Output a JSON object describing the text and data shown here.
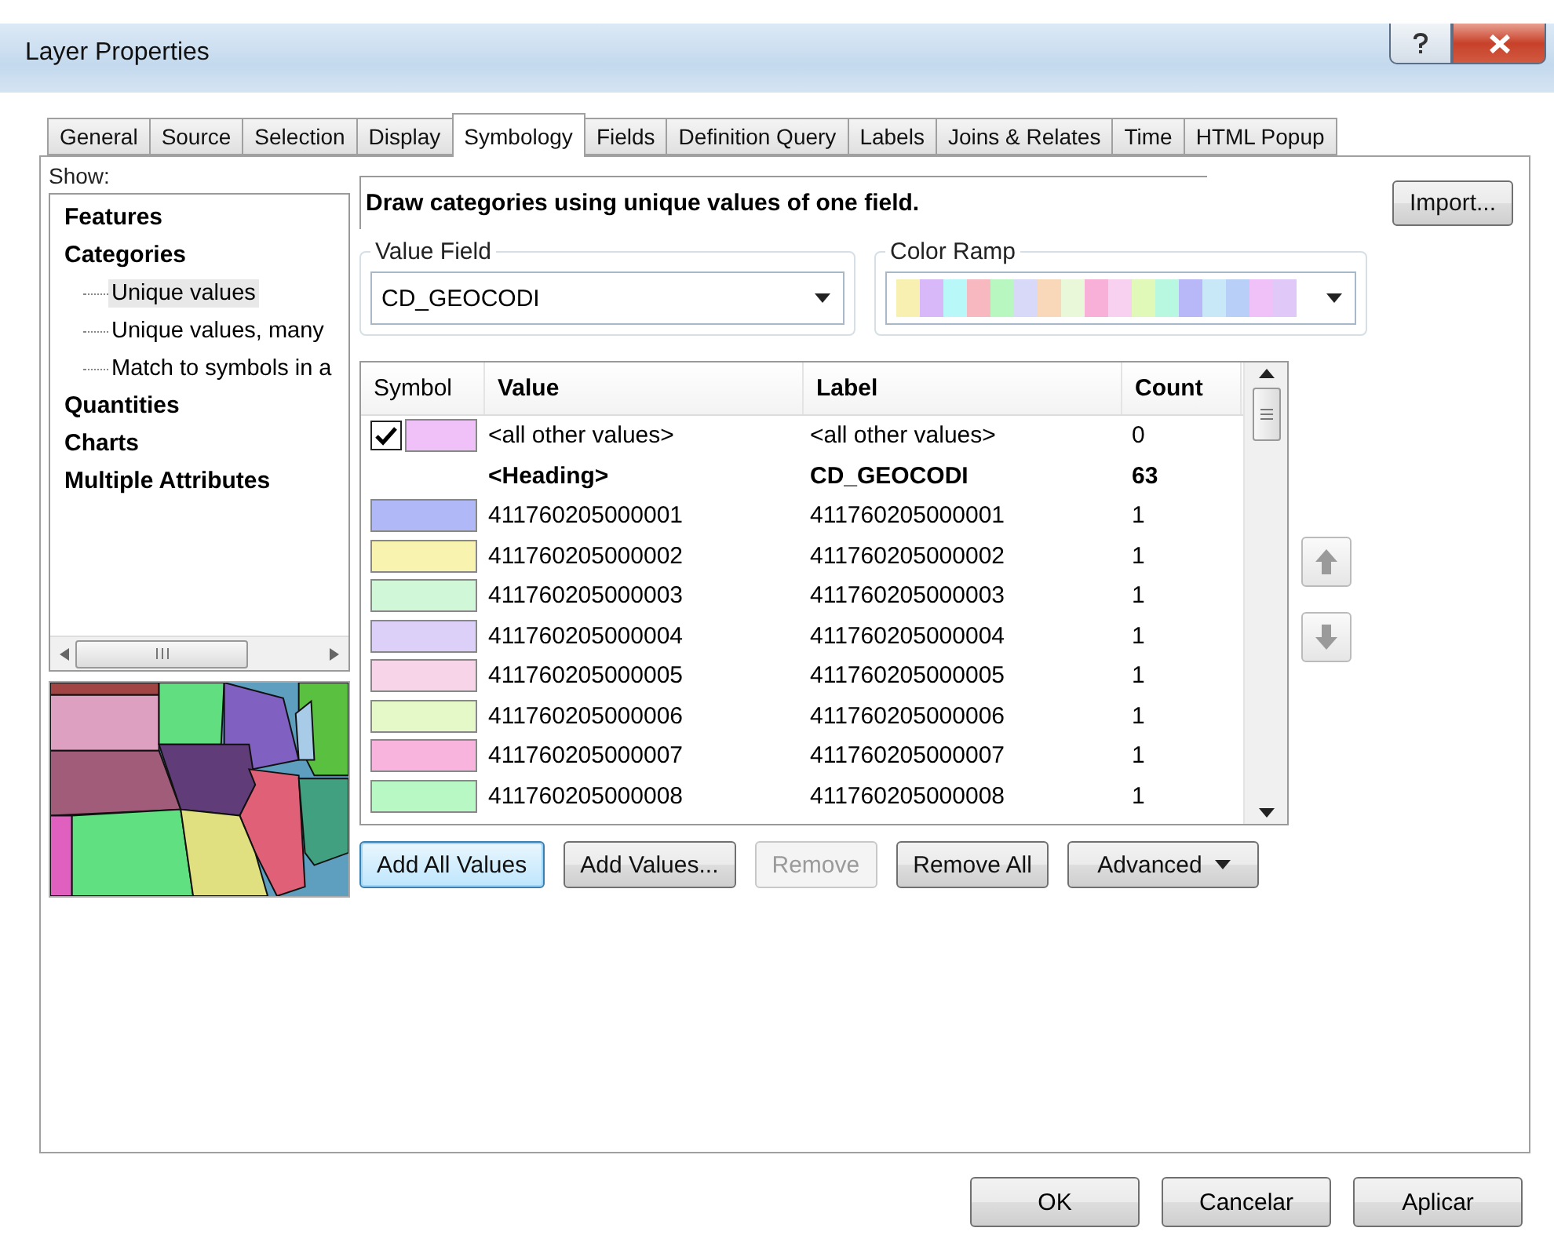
{
  "window": {
    "title": "Layer Properties"
  },
  "tabs": [
    {
      "label": "General",
      "selected": false
    },
    {
      "label": "Source",
      "selected": false
    },
    {
      "label": "Selection",
      "selected": false
    },
    {
      "label": "Display",
      "selected": false
    },
    {
      "label": "Symbology",
      "selected": true
    },
    {
      "label": "Fields",
      "selected": false
    },
    {
      "label": "Definition Query",
      "selected": false
    },
    {
      "label": "Labels",
      "selected": false
    },
    {
      "label": "Joins & Relates",
      "selected": false
    },
    {
      "label": "Time",
      "selected": false
    },
    {
      "label": "HTML Popup",
      "selected": false
    }
  ],
  "show": {
    "label": "Show:",
    "items": [
      {
        "label": "Features",
        "selected": false
      },
      {
        "label": "Categories",
        "selected": false,
        "children": [
          {
            "label": "Unique values",
            "selected": true
          },
          {
            "label": "Unique values, many",
            "selected": false
          },
          {
            "label": "Match to symbols in a",
            "selected": false
          }
        ]
      },
      {
        "label": "Quantities",
        "selected": false
      },
      {
        "label": "Charts",
        "selected": false
      },
      {
        "label": "Multiple Attributes",
        "selected": false
      }
    ]
  },
  "preview": {
    "kind": "picture"
  },
  "description": "Draw categories using unique values of one field.",
  "import_button": "Import...",
  "value_field": {
    "label": "Value Field",
    "value": "CD_GEOCODI"
  },
  "color_ramp": {
    "label": "Color Ramp",
    "colors": [
      {
        "color": "#f8f0b0"
      },
      {
        "color": "#d8b8f8"
      },
      {
        "color": "#b8f8f8"
      },
      {
        "color": "#f8b8c0"
      },
      {
        "color": "#b8f8c0"
      },
      {
        "color": "#d8d8f8"
      },
      {
        "color": "#f8d8b8"
      },
      {
        "color": "#e8f8d8"
      },
      {
        "color": "#f8b0d8"
      },
      {
        "color": "#f8d0f0"
      },
      {
        "color": "#e0f8b8"
      },
      {
        "color": "#b8f8e0"
      },
      {
        "color": "#b8b8f8"
      },
      {
        "color": "#c8e8f8"
      },
      {
        "color": "#b8d0f8"
      },
      {
        "color": "#f0c0f8"
      },
      {
        "color": "#e0c8f8"
      }
    ]
  },
  "table": {
    "columns": [
      "Symbol",
      "Value",
      "Label",
      "Count"
    ],
    "rows": [
      {
        "kind": "other",
        "checked": true,
        "color": "#f0c0f8",
        "value": "<all other values>",
        "label": "<all other values>",
        "count": "0"
      },
      {
        "kind": "heading",
        "value": "<Heading>",
        "label": "CD_GEOCODI",
        "count": "63"
      },
      {
        "kind": "value",
        "color": "#b0b8f8",
        "value": "411760205000001",
        "label": "411760205000001",
        "count": "1"
      },
      {
        "kind": "value",
        "color": "#f8f4b0",
        "value": "411760205000002",
        "label": "411760205000002",
        "count": "1"
      },
      {
        "kind": "value",
        "color": "#d0f8d8",
        "value": "411760205000003",
        "label": "411760205000003",
        "count": "1"
      },
      {
        "kind": "value",
        "color": "#dcd0f8",
        "value": "411760205000004",
        "label": "411760205000004",
        "count": "1"
      },
      {
        "kind": "value",
        "color": "#f8d4e8",
        "value": "411760205000005",
        "label": "411760205000005",
        "count": "1"
      },
      {
        "kind": "value",
        "color": "#e4f8c8",
        "value": "411760205000006",
        "label": "411760205000006",
        "count": "1"
      },
      {
        "kind": "value",
        "color": "#f8b4dc",
        "value": "411760205000007",
        "label": "411760205000007",
        "count": "1"
      },
      {
        "kind": "value",
        "color": "#b8f8c4",
        "value": "411760205000008",
        "label": "411760205000008",
        "count": "1"
      }
    ]
  },
  "table_buttons": [
    {
      "label": "Add All Values",
      "disabled": false,
      "focused": true
    },
    {
      "label": "Add Values...",
      "disabled": false,
      "focused": false
    },
    {
      "label": "Remove",
      "disabled": true,
      "focused": false
    },
    {
      "label": "Remove All",
      "disabled": false,
      "focused": false
    },
    {
      "label": "Advanced",
      "disabled": false,
      "focused": false,
      "kind": "dropdown"
    }
  ],
  "dialog_buttons": [
    "OK",
    "Cancelar",
    "Aplicar"
  ]
}
